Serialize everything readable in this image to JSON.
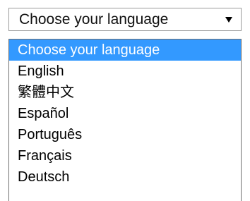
{
  "select": {
    "current_value": "Choose your language"
  },
  "options": [
    {
      "label": "Choose your language",
      "selected": true
    },
    {
      "label": "English",
      "selected": false
    },
    {
      "label": "繁體中文",
      "selected": false
    },
    {
      "label": "Español",
      "selected": false
    },
    {
      "label": "Português",
      "selected": false
    },
    {
      "label": "Français",
      "selected": false
    },
    {
      "label": "Deutsch",
      "selected": false
    }
  ],
  "icons": {
    "dropdown_arrow": "triangle-down-icon"
  },
  "colors": {
    "highlight_bg": "#3399ff",
    "highlight_text": "#ffffff",
    "border": "#9a9a9a"
  }
}
